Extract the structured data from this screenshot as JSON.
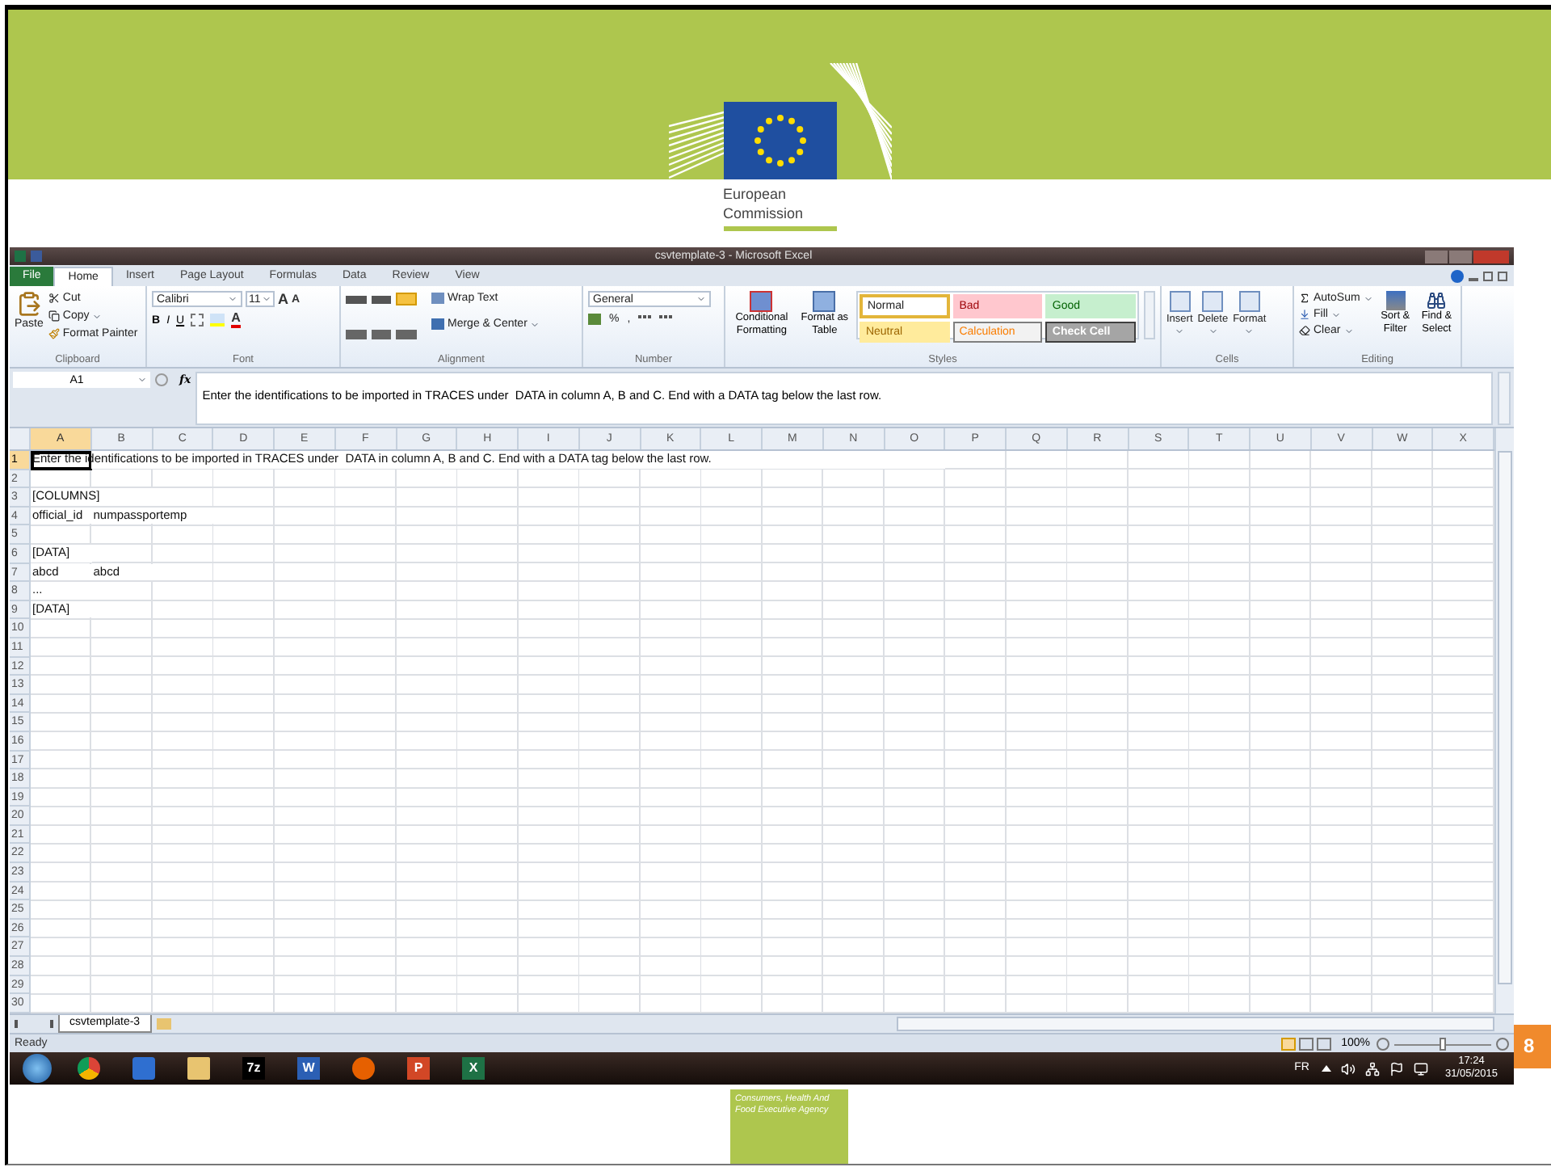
{
  "slide": {
    "logo_lines": [
      "European",
      "Commission"
    ],
    "page_number": "8",
    "agency_label": "Consumers, Health And Food Executive Agency"
  },
  "excel": {
    "title": "csvtemplate-3 - Microsoft Excel",
    "file_tab": "File",
    "tabs": [
      {
        "label": "Home",
        "selected": true
      },
      {
        "label": "Insert",
        "selected": false
      },
      {
        "label": "Page Layout",
        "selected": false
      },
      {
        "label": "Formulas",
        "selected": false
      },
      {
        "label": "Data",
        "selected": false
      },
      {
        "label": "Review",
        "selected": false
      },
      {
        "label": "View",
        "selected": false
      }
    ],
    "ribbon": {
      "clipboard": {
        "paste": "Paste",
        "cut": "Cut",
        "copy": "Copy",
        "format_painter": "Format Painter",
        "label": "Clipboard"
      },
      "font": {
        "name": "Calibri",
        "size": "11",
        "grow": "A",
        "shrink": "A",
        "bold": "B",
        "italic": "I",
        "underline": "U",
        "text_color_button": "A",
        "label": "Font"
      },
      "alignment": {
        "wrap_text": "Wrap Text",
        "merge": "Merge & Center",
        "label": "Alignment"
      },
      "number": {
        "format": "General",
        "percent": "%",
        "comma": ",",
        "label": "Number"
      },
      "styles": {
        "conditional": "Conditional Formatting",
        "format_table": "Format as Table",
        "label": "Styles",
        "cell_styles": [
          {
            "label": "Normal",
            "kind": "normal",
            "selected": true
          },
          {
            "label": "Bad",
            "kind": "bad",
            "selected": false
          },
          {
            "label": "Good",
            "kind": "good",
            "selected": false
          },
          {
            "label": "Neutral",
            "kind": "neutral",
            "selected": false
          },
          {
            "label": "Calculation",
            "kind": "calculation",
            "selected": false
          },
          {
            "label": "Check Cell",
            "kind": "check",
            "selected": false
          }
        ]
      },
      "cells": {
        "buttons": [
          "Insert",
          "Delete",
          "Format"
        ],
        "label": "Cells"
      },
      "editing": {
        "autosum": "AutoSum",
        "fill": "Fill",
        "clear": "Clear",
        "sort": "Sort & Filter",
        "find": "Find & Select",
        "label": "Editing"
      }
    },
    "formula_bar": {
      "name_box": "A1",
      "fx": "fx",
      "content": "Enter the identifications to be imported in TRACES under  DATA in column A, B and C. End with a DATA tag below the last row."
    },
    "sheet": {
      "columns": [
        {
          "label": "A",
          "selected": true
        },
        {
          "label": "B",
          "selected": false
        },
        {
          "label": "C",
          "selected": false
        },
        {
          "label": "D",
          "selected": false
        },
        {
          "label": "E",
          "selected": false
        },
        {
          "label": "F",
          "selected": false
        },
        {
          "label": "G",
          "selected": false
        },
        {
          "label": "H",
          "selected": false
        },
        {
          "label": "I",
          "selected": false
        },
        {
          "label": "J",
          "selected": false
        },
        {
          "label": "K",
          "selected": false
        },
        {
          "label": "L",
          "selected": false
        },
        {
          "label": "M",
          "selected": false
        },
        {
          "label": "N",
          "selected": false
        },
        {
          "label": "O",
          "selected": false
        },
        {
          "label": "P",
          "selected": false
        },
        {
          "label": "Q",
          "selected": false
        },
        {
          "label": "R",
          "selected": false
        },
        {
          "label": "S",
          "selected": false
        },
        {
          "label": "T",
          "selected": false
        },
        {
          "label": "U",
          "selected": false
        },
        {
          "label": "V",
          "selected": false
        },
        {
          "label": "W",
          "selected": false
        },
        {
          "label": "X",
          "selected": false
        }
      ],
      "rows": [
        {
          "number": "1",
          "selected": true,
          "cells": [
            "Enter the identifications to be imported in TRACES under  DATA in column A, B and C. End with a DATA tag below the last row."
          ]
        },
        {
          "number": "2",
          "selected": false
        },
        {
          "number": "3",
          "selected": false,
          "cells": [
            "[COLUMNS]"
          ]
        },
        {
          "number": "4",
          "selected": false,
          "cells": [
            "official_id",
            "numpassportemp"
          ]
        },
        {
          "number": "5",
          "selected": false
        },
        {
          "number": "6",
          "selected": false,
          "cells": [
            "[DATA]"
          ]
        },
        {
          "number": "7",
          "selected": false,
          "cells": [
            "abcd",
            "abcd"
          ]
        },
        {
          "number": "8",
          "selected": false,
          "cells": [
            "..."
          ]
        },
        {
          "number": "9",
          "selected": false,
          "cells": [
            "[DATA]"
          ]
        },
        {
          "number": "10",
          "selected": false
        },
        {
          "number": "11",
          "selected": false
        },
        {
          "number": "12",
          "selected": false
        },
        {
          "number": "13",
          "selected": false
        },
        {
          "number": "14",
          "selected": false
        },
        {
          "number": "15",
          "selected": false
        },
        {
          "number": "16",
          "selected": false
        },
        {
          "number": "17",
          "selected": false
        },
        {
          "number": "18",
          "selected": false
        },
        {
          "number": "19",
          "selected": false
        },
        {
          "number": "20",
          "selected": false
        },
        {
          "number": "21",
          "selected": false
        },
        {
          "number": "22",
          "selected": false
        },
        {
          "number": "23",
          "selected": false
        },
        {
          "number": "24",
          "selected": false
        },
        {
          "number": "25",
          "selected": false
        },
        {
          "number": "26",
          "selected": false
        },
        {
          "number": "27",
          "selected": false
        },
        {
          "number": "28",
          "selected": false
        },
        {
          "number": "29",
          "selected": false
        },
        {
          "number": "30",
          "selected": false
        }
      ]
    },
    "sheet_tab": {
      "label": "csvtemplate-3",
      "selected": true
    },
    "status": "Ready",
    "zoom": {
      "label": "100%",
      "level": 0.5
    }
  },
  "taskbar": {
    "apps": [
      {
        "kind": "start"
      },
      {
        "kind": "chrome"
      },
      {
        "kind": "media"
      },
      {
        "kind": "folder"
      },
      {
        "kind": "archive",
        "label": "7z"
      },
      {
        "kind": "word",
        "label": "W"
      },
      {
        "kind": "firefox"
      },
      {
        "kind": "powerpoint",
        "label": "P"
      },
      {
        "kind": "excel",
        "label": "X"
      }
    ],
    "language": "FR",
    "time": "17:24",
    "date": "31/05/2015"
  }
}
